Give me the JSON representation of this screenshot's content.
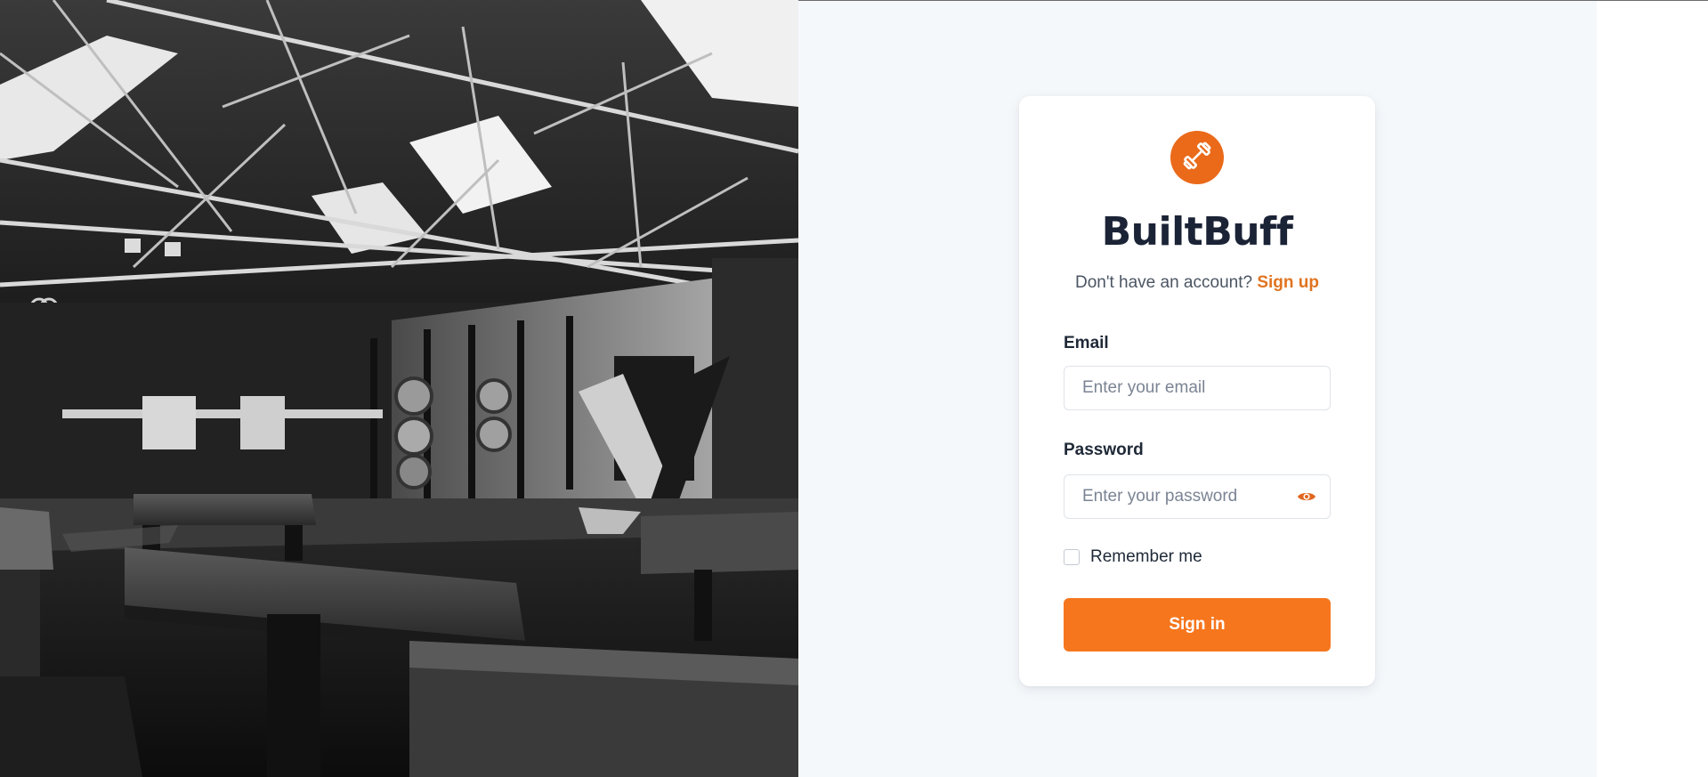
{
  "brand": {
    "name": "BuiltBuff",
    "logo_icon": "dumbbell-icon",
    "accent_color": "#f6761d"
  },
  "signup": {
    "prompt": "Don't have an account?",
    "link_label": "Sign up"
  },
  "form": {
    "email": {
      "label": "Email",
      "placeholder": "Enter your email",
      "value": ""
    },
    "password": {
      "label": "Password",
      "placeholder": "Enter your password",
      "value": "",
      "toggle_icon": "eye-icon"
    },
    "remember": {
      "label": "Remember me",
      "checked": false
    },
    "submit_label": "Sign in"
  },
  "hero_image": {
    "icon": "gym-interior-photo"
  }
}
